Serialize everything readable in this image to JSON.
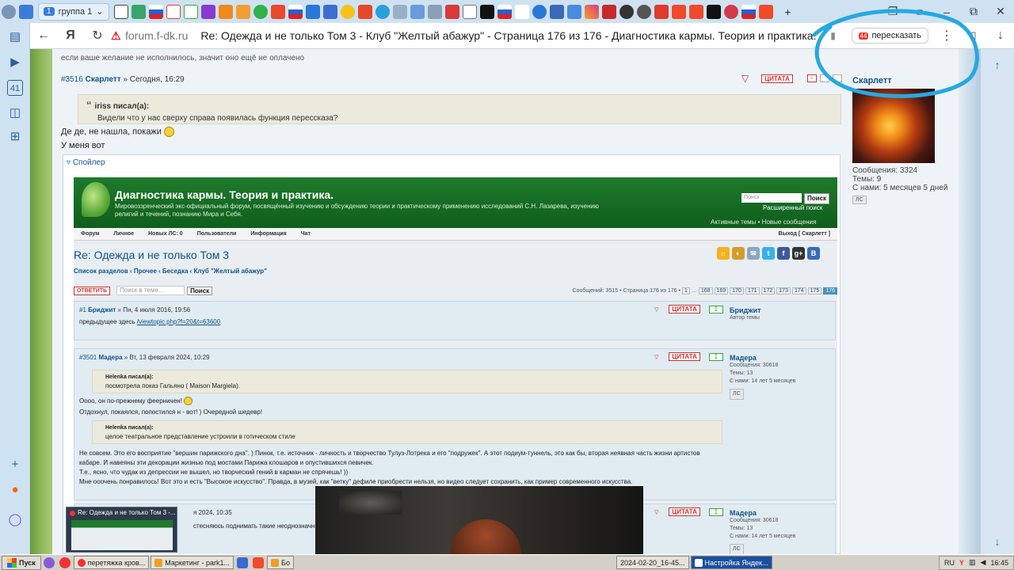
{
  "browser": {
    "tab_group_count": "1",
    "tab_group_label": "группа 1",
    "domain": "forum.f-dk.ru",
    "page_title": "Re: Одежда и не только Том 3 - Клуб \"Желтый абажур\" - Страница 176 из 176 - Диагностика кармы. Теория и практика.",
    "summarize_badge": "44",
    "summarize_label": "пересказать",
    "sidebar_counter": "41"
  },
  "forum": {
    "top_note": "если ваше желание не исполнилось, значит оно ещё не оплачено",
    "post": {
      "number": "#3516",
      "author": "Скарлетт",
      "date": "» Сегодня, 16:29",
      "cite_label": "ЦИТАТА",
      "quote_author": "iriss писал(а):",
      "quote_text": "Видели что у нас сверху справа появилась функция перессказа?",
      "line1": "Де де, не нашла, покажи",
      "line2": "У меня вот",
      "spoiler_label": "Спойлер"
    },
    "author_panel": {
      "name": "Скарлетт",
      "messages": "Сообщения: 3324",
      "topics": "Темы: 9",
      "member_since": "С нами: 5 месяцев 5 дней",
      "pm_label": "ЛС"
    }
  },
  "inner": {
    "site_title": "Диагностика кармы. Теория и практика.",
    "site_desc": "Мировоззренческий экс-официальный форум, посвящённый изучению и обсуждению теории и практическому применению исследований С.Н. Лазарева, изучению религий и течений, познанию Мира и Себя.",
    "search_placeholder": "Поиск",
    "search_button": "Поиск",
    "advanced_search": "Расширенный поиск",
    "active_topics": "Активные темы • Новые сообщения",
    "nav": {
      "forum": "Форум",
      "personal": "Личное",
      "new_pm": "Новых ЛС: 0",
      "users": "Пользователи",
      "info": "Информация",
      "chat": "Чат",
      "exit": "Выход [ Скарлетт ]"
    },
    "topic_title": "Re: Одежда и не только Том 3",
    "breadcrumbs": "Список разделов ‹ Прочее ‹ Беседка ‹ Клуб \"Желтый абажур\"",
    "social": [
      "☼",
      "◐",
      "✉",
      "t",
      "f",
      "g+",
      "B"
    ],
    "reply_button": "ОТВЕТИТЬ",
    "topic_search_placeholder": "Поиск в теме...",
    "topic_search_button": "Поиск",
    "pagination": {
      "info": "Сообщений: 3515 • Страница 176 из 176 •",
      "first": "1",
      "pages": [
        "168",
        "169",
        "170",
        "171",
        "172",
        "173",
        "174",
        "175"
      ],
      "current": "176"
    },
    "posts": [
      {
        "number": "#1",
        "author": "Бриджит",
        "date": "» Пн, 4 июля 2016, 19:56",
        "body": "предыдущее здесь",
        "link": "/viewtopic.php?f=20&t=63600",
        "cite": "ЦИТАТА",
        "rating": "1",
        "side_name": "Бриджит",
        "side_role": "Автор темы"
      },
      {
        "number": "#3501",
        "author": "Мадера",
        "date": "» Вт, 13 февраля 2024, 10:29",
        "cite": "ЦИТАТА",
        "rating": "1",
        "q1_author": "Helenka писал(а):",
        "q1_text": "посмотрела показ Гальяно ( Maison Margiela).",
        "line1": "Оооо, он по-прежнему феерничен!",
        "line2": "Отдохнул, покаялся, попостился н - вот! ) Очередной шедевр!",
        "q2_author": "Helenka писал(а):",
        "q2_text": "целое театральное представление устроили в готическом стиле",
        "p1": "Не совсем. Это его восприятие \"вершин парижского дна\". ) Пинок, т.е. источник - личность и творчество Тулуз-Лотрека и его \"подружек\". А этот подиум-туннель, это как бы, вторая неявная часть жизни артистов кабаре. И навеяны эти декорации жизнью под мостами Парижа клошаров и опустившихся певичек.",
        "p2": "Т.е., ясно, что чудак из депрессии не вышел, но творческий гений в карман не спрячешь! ))",
        "p3": "Мне ооочень понравилось! Вот это и есть \"Высокое искусство\". Правда, в музей, как \"ветку\" дефиле приобрести нельзя, но видео следует сохранить, как пример современного искусства.",
        "side_name": "Мадера",
        "side_messages": "Сообщения: 30618",
        "side_topics": "Темы: 13",
        "side_since": "С нами: 14 лет 5 месяцев"
      },
      {
        "time_fragment": "я 2024, 10:35",
        "body_fragment": "стесняюсь поднимать такие неоднозначны",
        "cite": "ЦИТАТА",
        "rating": "1",
        "side_name": "Мадера",
        "side_messages": "Сообщения: 30618",
        "side_topics": "Темы: 13",
        "side_since": "С нами: 14 лет 5 месяцев"
      }
    ]
  },
  "overlays": {
    "thumbnail_title": "Re: Одежда и не только Том 3 -..."
  },
  "taskbar": {
    "start": "Пуск",
    "tasks": [
      {
        "label": "перетяжка кров..."
      },
      {
        "label": "Маркетинг - park1..."
      },
      {
        "label": "Бо"
      },
      {
        "label": "2024-02-20_16-45..."
      },
      {
        "label": "Настройка Яндек..."
      }
    ],
    "lang": "RU",
    "clock": "16:45"
  },
  "colors": {
    "forum_link": "#105289",
    "header_green": "#1e7a2c",
    "scribble": "#27a8e0",
    "accent_red": "#cc3333"
  }
}
